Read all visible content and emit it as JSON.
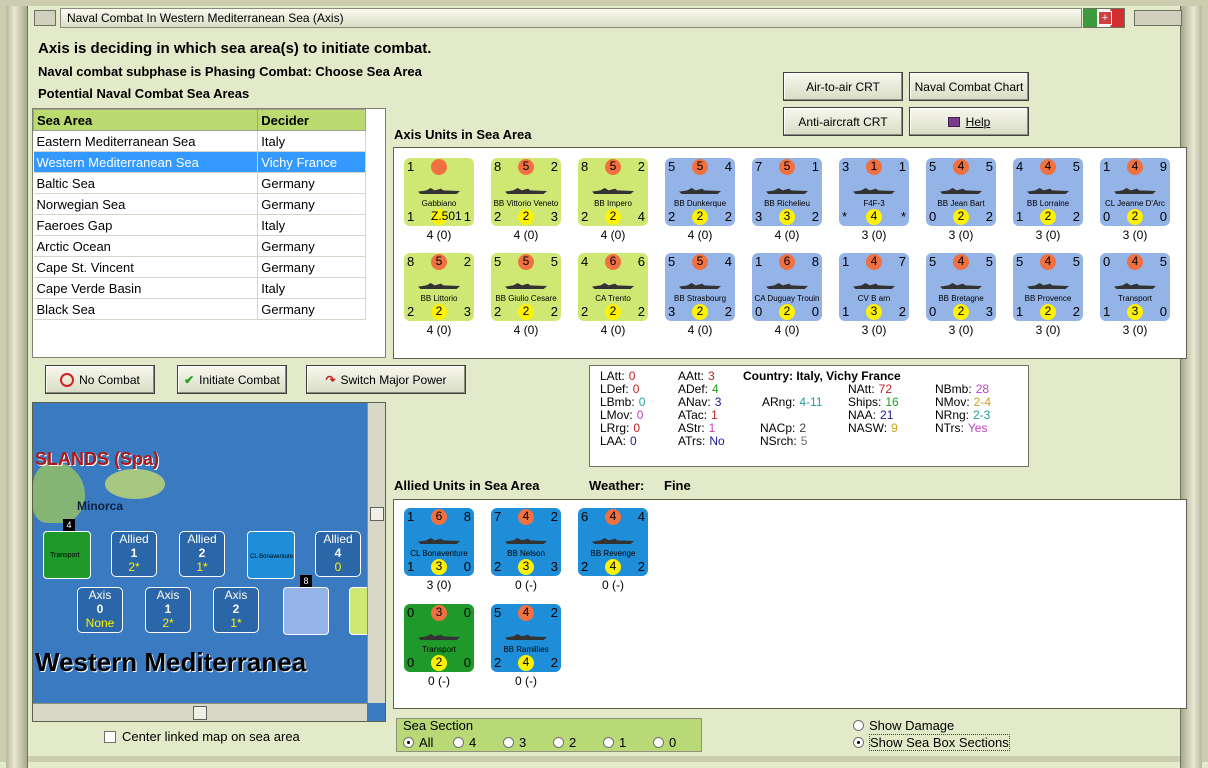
{
  "window": {
    "title": "Naval Combat In Western Mediterranean Sea (Axis)"
  },
  "header": {
    "line1": "Axis is deciding in which sea area(s) to initiate combat.",
    "line2": "Naval combat subphase is Phasing Combat: Choose Sea Area",
    "line3": "Potential Naval Combat Sea Areas"
  },
  "buttons": {
    "air_to_air": "Air-to-air CRT",
    "naval_chart": "Naval Combat Chart",
    "anti_aircraft": "Anti-aircraft CRT",
    "help": "Help",
    "no_combat": "No Combat",
    "initiate_combat": "Initiate Combat",
    "switch_major_power": "Switch Major Power"
  },
  "table": {
    "headers": [
      "Sea Area",
      "Decider"
    ],
    "rows": [
      [
        "Eastern Mediterranean Sea",
        "Italy"
      ],
      [
        "Western Mediterranean Sea",
        "Vichy France"
      ],
      [
        "Baltic Sea",
        "Germany"
      ],
      [
        "Norwegian Sea",
        "Germany"
      ],
      [
        "Faeroes Gap",
        "Italy"
      ],
      [
        "Arctic Ocean",
        "Germany"
      ],
      [
        "Cape St. Vincent",
        "Germany"
      ],
      [
        "Cape Verde Basin",
        "Italy"
      ],
      [
        "Black Sea",
        "Germany"
      ]
    ]
  },
  "axis_units_label": "Axis Units in Sea Area",
  "allied_units_label": "Allied Units in Sea Area",
  "weather": {
    "label": "Weather:",
    "value": "Fine"
  },
  "axis_units": [
    {
      "tl": "1",
      "tc": "",
      "tr": "",
      "name": "Gabbiano",
      "bl": "1",
      "bc": "Z.501",
      "br": "1",
      "s": "4 (0)",
      "c": "ay"
    },
    {
      "tl": "8",
      "tc": "5",
      "tr": "2",
      "name": "BB Vittorio Veneto",
      "bl": "2",
      "bc": "2",
      "br": "3",
      "s": "4 (0)",
      "c": "ay"
    },
    {
      "tl": "8",
      "tc": "5",
      "tr": "2",
      "name": "BB Impero",
      "bl": "2",
      "bc": "2",
      "br": "4",
      "s": "4 (0)",
      "c": "ay"
    },
    {
      "tl": "5",
      "tc": "5",
      "tr": "4",
      "name": "BB Dunkerque",
      "bl": "2",
      "bc": "2",
      "br": "2",
      "s": "4 (0)",
      "c": "ab"
    },
    {
      "tl": "7",
      "tc": "5",
      "tr": "1",
      "name": "BB Richelieu",
      "bl": "3",
      "bc": "3",
      "br": "2",
      "s": "4 (0)",
      "c": "ab"
    },
    {
      "tl": "3",
      "tc": "1",
      "tr": "1",
      "name": "F4F-3",
      "bl": "*",
      "bc": "4",
      "br": "*",
      "s": "3 (0)",
      "c": "ab"
    },
    {
      "tl": "5",
      "tc": "4",
      "tr": "5",
      "name": "BB Jean Bart",
      "bl": "0",
      "bc": "2",
      "br": "2",
      "s": "3 (0)",
      "c": "ab"
    },
    {
      "tl": "4",
      "tc": "4",
      "tr": "5",
      "name": "BB Lorraine",
      "bl": "1",
      "bc": "2",
      "br": "2",
      "s": "3 (0)",
      "c": "ab"
    },
    {
      "tl": "1",
      "tc": "4",
      "tr": "9",
      "name": "CL Jeanne D'Arc",
      "bl": "0",
      "bc": "2",
      "br": "0",
      "s": "3 (0)",
      "c": "ab"
    },
    {
      "tl": "8",
      "tc": "5",
      "tr": "2",
      "name": "BB Littorio",
      "bl": "2",
      "bc": "2",
      "br": "3",
      "s": "4 (0)",
      "c": "ay"
    },
    {
      "tl": "5",
      "tc": "5",
      "tr": "5",
      "name": "BB Giulio Cesare",
      "bl": "2",
      "bc": "2",
      "br": "2",
      "s": "4 (0)",
      "c": "ay"
    },
    {
      "tl": "4",
      "tc": "6",
      "tr": "6",
      "name": "CA Trento",
      "bl": "2",
      "bc": "2",
      "br": "2",
      "s": "4 (0)",
      "c": "ay"
    },
    {
      "tl": "5",
      "tc": "5",
      "tr": "4",
      "name": "BB Strasbourg",
      "bl": "3",
      "bc": "2",
      "br": "2",
      "s": "4 (0)",
      "c": "ab"
    },
    {
      "tl": "1",
      "tc": "6",
      "tr": "8",
      "name": "CA Duguay Trouin",
      "bl": "0",
      "bc": "2",
      "br": "0",
      "s": "4 (0)",
      "c": "ab"
    },
    {
      "tl": "1",
      "tc": "4",
      "tr": "7",
      "name": "CV B arn",
      "bl": "1",
      "bc": "3",
      "br": "2",
      "s": "3 (0)",
      "c": "ab"
    },
    {
      "tl": "5",
      "tc": "4",
      "tr": "5",
      "name": "BB Bretagne",
      "bl": "0",
      "bc": "2",
      "br": "3",
      "s": "3 (0)",
      "c": "ab"
    },
    {
      "tl": "5",
      "tc": "4",
      "tr": "5",
      "name": "BB Provence",
      "bl": "1",
      "bc": "2",
      "br": "2",
      "s": "3 (0)",
      "c": "ab"
    },
    {
      "tl": "0",
      "tc": "4",
      "tr": "5",
      "name": "Transport",
      "bl": "1",
      "bc": "3",
      "br": "0",
      "s": "3 (0)",
      "c": "ab"
    }
  ],
  "allied_units": [
    {
      "tl": "1",
      "tc": "6",
      "tr": "8",
      "name": "CL Bonaventure",
      "bl": "1",
      "bc": "3",
      "br": "0",
      "s": "3 (0)",
      "c": "al"
    },
    {
      "tl": "7",
      "tc": "4",
      "tr": "2",
      "name": "BB Nelson",
      "bl": "2",
      "bc": "3",
      "br": "3",
      "s": "0 (-)",
      "c": "al"
    },
    {
      "tl": "6",
      "tc": "4",
      "tr": "4",
      "name": "BB Revenge",
      "bl": "2",
      "bc": "4",
      "br": "2",
      "s": "0 (-)",
      "c": "al"
    },
    {
      "tl": "0",
      "tc": "3",
      "tr": "0",
      "name": "Transport",
      "bl": "0",
      "bc": "2",
      "br": "0",
      "s": "0 (-)",
      "c": "ag"
    },
    {
      "tl": "5",
      "tc": "4",
      "tr": "2",
      "name": "BB Ramillies",
      "bl": "2",
      "bc": "4",
      "br": "2",
      "s": "0 (-)",
      "c": "al"
    }
  ],
  "stats": {
    "country_label": "Country:",
    "country": "Italy, Vichy France",
    "c1": [
      [
        "LAtt:",
        "0"
      ],
      [
        "LDef:",
        "0"
      ],
      [
        "LBmb:",
        "0"
      ],
      [
        "LMov:",
        "0"
      ],
      [
        "LRrg:",
        "0"
      ],
      [
        "LAA:",
        "0"
      ]
    ],
    "c2": [
      [
        "AAtt:",
        "3"
      ],
      [
        "ADef:",
        "4"
      ],
      [
        "ANav:",
        "3"
      ],
      [
        "ATac:",
        "1"
      ],
      [
        "AStr:",
        "1"
      ],
      [
        "ATrs:",
        "No"
      ]
    ],
    "arng": [
      "ARng:",
      "4-11"
    ],
    "nacp": [
      "NACp:",
      "2"
    ],
    "nsrch": [
      "NSrch:",
      "5"
    ],
    "c4": [
      [
        "NAtt:",
        "72"
      ],
      [
        "Ships:",
        "16"
      ],
      [
        "NAA:",
        "21"
      ],
      [
        "NASW:",
        "9"
      ]
    ],
    "c5": [
      [
        "NBmb:",
        "28"
      ],
      [
        "NMov:",
        "2-4"
      ],
      [
        "NRng:",
        "2-3"
      ],
      [
        "NTrs:",
        "Yes"
      ]
    ]
  },
  "map": {
    "islands": "SLANDS (Spa)",
    "minorca": "Minorca",
    "sea_name": "Western Mediterranea",
    "allied_boxes": [
      {
        "side": "Allied",
        "num": "1",
        "val": "2*"
      },
      {
        "side": "Allied",
        "num": "2",
        "val": "1*"
      },
      {
        "side": "Allied",
        "num": "4",
        "val": "0"
      }
    ],
    "axis_boxes": [
      {
        "side": "Axis",
        "num": "0",
        "val": "None"
      },
      {
        "side": "Axis",
        "num": "1",
        "val": "2*"
      },
      {
        "side": "Axis",
        "num": "2",
        "val": "1*"
      }
    ],
    "badge4": "4",
    "badge8": "8",
    "mini_transport": "Transport",
    "mini_bonaventure": "CL Bonaventure"
  },
  "center_map": "Center linked map on sea area",
  "sea_section": {
    "label": "Sea Section",
    "options": [
      "All",
      "4",
      "3",
      "2",
      "1",
      "0"
    ],
    "selected": "All"
  },
  "show_damage": "Show Damage",
  "show_sections": "Show Sea Box Sections"
}
